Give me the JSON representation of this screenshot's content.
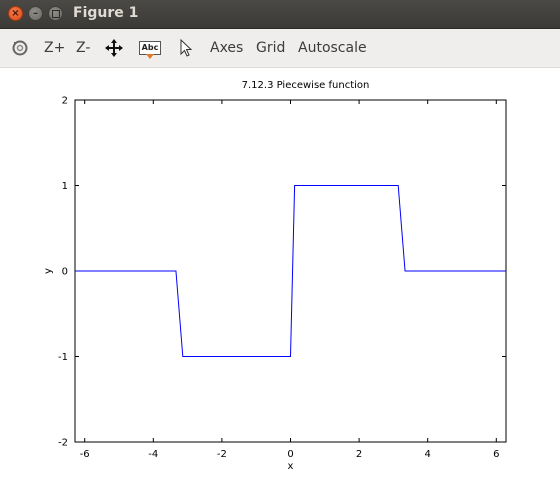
{
  "window": {
    "title": "Figure 1"
  },
  "toolbar": {
    "rotate_icon": "rotate-icon",
    "zoom_in_label": "Z+",
    "zoom_out_label": "Z-",
    "pan_icon": "pan-arrows-icon",
    "text_tool_label": "Abc",
    "select_icon": "pointer-arrow-icon",
    "axes_label": "Axes",
    "grid_label": "Grid",
    "autoscale_label": "Autoscale"
  },
  "chart_data": {
    "type": "line",
    "title": "7.12.3 Piecewise function",
    "xlabel": "x",
    "ylabel": "y",
    "xlim": [
      -6.283,
      6.283
    ],
    "ylim": [
      -2,
      2
    ],
    "x_ticks": [
      "-6",
      "-4",
      "-2",
      "0",
      "2",
      "4",
      "6"
    ],
    "y_ticks": [
      "2",
      "1",
      "0",
      "-1",
      "-2"
    ],
    "grid": false,
    "series": [
      {
        "color": "#0000ff",
        "x": [
          -6.283,
          -3.34,
          -3.14,
          0.0,
          0.12,
          3.14,
          3.34,
          6.283
        ],
        "y": [
          0,
          0,
          -1,
          -1,
          1,
          1,
          0,
          0
        ]
      }
    ]
  }
}
